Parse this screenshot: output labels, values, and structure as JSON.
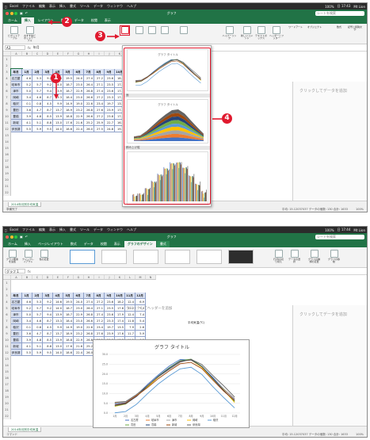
{
  "menubar": [
    "Excel",
    "ファイル",
    "編集",
    "表示",
    "挿入",
    "書式",
    "ツール",
    "データ",
    "ウィンドウ",
    "ヘルプ"
  ],
  "status_right": [
    "100%",
    "日 17:43",
    "Mt Lion"
  ],
  "status_right_2": [
    "100%",
    "日 17:44",
    "Mt Lion"
  ],
  "window_title": "グラフ",
  "search_placeholder": "シートを検索",
  "tabs_top": [
    "ホーム",
    "挿入",
    "レイアウト",
    "数式",
    "データ",
    "校閲",
    "表示"
  ],
  "tabs_bottom": [
    "ホーム",
    "挿入",
    "ページレイアウト",
    "数式",
    "データ",
    "校閲",
    "表示",
    "グラフのデザイン",
    "書式"
  ],
  "ribbon_top": [
    "ピボットテーブル",
    "おすすめピボットテーブル",
    "ハイパーリンク",
    "新しいコメント",
    "テキストボックス",
    "ヘッダーとフッター",
    "ワードアート",
    "オブジェクト",
    "数式",
    "記号と特殊文字"
  ],
  "ribbon_bottom": [
    "グラフ要素を追加",
    "クイックレイアウト",
    "色の変更",
    "行/列の切り替え",
    "データの選択",
    "グラフの種類の変更",
    "グラフの移動"
  ],
  "namebox_top": "A3",
  "formula_top": "年月",
  "namebox_bottom": "グラフ 1",
  "columns": [
    "A",
    "B",
    "C",
    "D",
    "E",
    "F",
    "G",
    "H",
    "I",
    "J",
    "K",
    "L",
    "M",
    "N"
  ],
  "table": {
    "header": [
      "年月",
      "1月",
      "2月",
      "3月",
      "4月",
      "5月",
      "6月",
      "7月",
      "8月",
      "9月",
      "10月",
      "11月",
      "12月"
    ],
    "rows": [
      [
        "名古屋",
        "4.6",
        "5.3",
        "9.2",
        "14.6",
        "19.5",
        "24.0",
        "27.4",
        "27.2",
        "23.6",
        "18.2",
        "12.4",
        "6.9"
      ],
      [
        "岐阜市",
        "5.2",
        "5.7",
        "9.2",
        "14.0",
        "18.7",
        "23.0",
        "26.4",
        "27.1",
        "23.5",
        "17.8",
        "12.2",
        "7.3"
      ],
      [
        "津市",
        "5.0",
        "5.7",
        "9.4",
        "13.9",
        "18.7",
        "22.9",
        "26.8",
        "27.4",
        "23.6",
        "17.9",
        "12.4",
        "7.4"
      ],
      [
        "岡崎",
        "3.4",
        "4.6",
        "8.7",
        "13.3",
        "18.4",
        "23.0",
        "26.6",
        "27.2",
        "23.3",
        "17.4",
        "11.8",
        "5.4"
      ],
      [
        "稲沢",
        "0.1",
        "0.8",
        "4.5",
        "9.9",
        "14.9",
        "19.0",
        "22.6",
        "23.4",
        "19.7",
        "13.5",
        "7.9",
        "2.6"
      ],
      [
        "豊田",
        "3.6",
        "4.7",
        "8.7",
        "13.7",
        "18.9",
        "23.2",
        "26.8",
        "27.6",
        "23.9",
        "17.6",
        "11.7",
        "5.9"
      ],
      [
        "豊橋",
        "3.9",
        "4.8",
        "8.5",
        "13.9",
        "18.8",
        "22.9",
        "26.6",
        "27.2",
        "23.8",
        "17.8",
        "11.5",
        "6.3"
      ],
      [
        "新城",
        "4.1",
        "5.1",
        "8.8",
        "13.0",
        "17.6",
        "21.6",
        "25.2",
        "25.9",
        "22.7",
        "16.9",
        "11.2",
        "6.4"
      ],
      [
        "伊良湖",
        "5.5",
        "5.9",
        "9.5",
        "14.0",
        "18.6",
        "22.4",
        "26.0",
        "27.5",
        "24.8",
        "19.2",
        "13.9",
        "8.2"
      ]
    ]
  },
  "unit_label": "平均気温(℃)",
  "pane_text": "クリックしてデータを追加",
  "header_text": "クリックしてヘッダーを追加",
  "gallery": {
    "item_title": "グラフ タイトル",
    "sep1": "面",
    "sep2": "積み上げ縦"
  },
  "chart_title": "グラフ タイトル",
  "chart_legend": [
    "名古屋",
    "岐阜市",
    "津市",
    "岡崎",
    "稲沢",
    "豊田",
    "豊橋",
    "新城",
    "伊良湖"
  ],
  "chart_yticks": [
    "30.0",
    "25.0",
    "20.0",
    "15.0",
    "10.0",
    "5.0",
    "0.0"
  ],
  "line_colors": [
    "#4472c4",
    "#ed7d31",
    "#a5a5a5",
    "#ffc000",
    "#5b9bd5",
    "#70ad47",
    "#264478",
    "#9e480e",
    "#636363"
  ],
  "sheet_tab": "2014年月別平均気温",
  "status_left_top": "準備完了",
  "status_left_bottom": "コマンド",
  "status_mid_top": "平均: 15.12037037    データの個数: 130    合計: 1633",
  "status_mid_bottom": "平均: 15.12037037    データの個数: 130    合計: 1633",
  "status_zoom": "100%",
  "badges": [
    "1",
    "2",
    "3",
    "4"
  ]
}
